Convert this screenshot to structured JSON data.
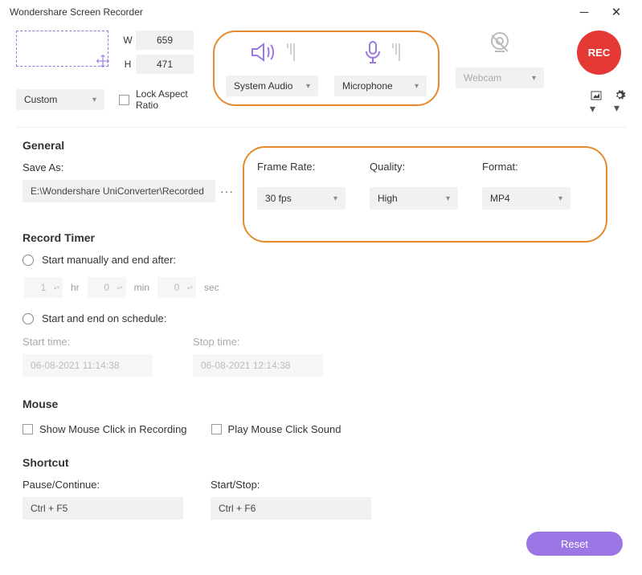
{
  "title": "Wondershare Screen Recorder",
  "dimensions": {
    "w_label": "W",
    "w_value": "659",
    "h_label": "H",
    "h_value": "471"
  },
  "preset": {
    "value": "Custom"
  },
  "lock_aspect": "Lock Aspect Ratio",
  "audio": {
    "system": "System Audio",
    "mic": "Microphone"
  },
  "webcam": "Webcam",
  "rec": "REC",
  "general": {
    "title": "General",
    "save_as_label": "Save As:",
    "save_path": "E:\\Wondershare UniConverter\\Recorded",
    "frame_rate_label": "Frame Rate:",
    "frame_rate": "30 fps",
    "quality_label": "Quality:",
    "quality": "High",
    "format_label": "Format:",
    "format": "MP4"
  },
  "timer": {
    "title": "Record Timer",
    "opt1": "Start manually and end after:",
    "hr_val": "1",
    "hr": "hr",
    "min_val": "0",
    "min": "min",
    "sec_val": "0",
    "sec": "sec",
    "opt2": "Start and end on schedule:",
    "start_label": "Start time:",
    "stop_label": "Stop time:",
    "start_val": "06-08-2021 11:14:38",
    "stop_val": "06-08-2021 12:14:38"
  },
  "mouse": {
    "title": "Mouse",
    "show_click": "Show Mouse Click in Recording",
    "play_sound": "Play Mouse Click Sound"
  },
  "shortcut": {
    "title": "Shortcut",
    "pause_label": "Pause/Continue:",
    "pause_val": "Ctrl + F5",
    "start_label": "Start/Stop:",
    "start_val": "Ctrl + F6"
  },
  "reset": "Reset"
}
